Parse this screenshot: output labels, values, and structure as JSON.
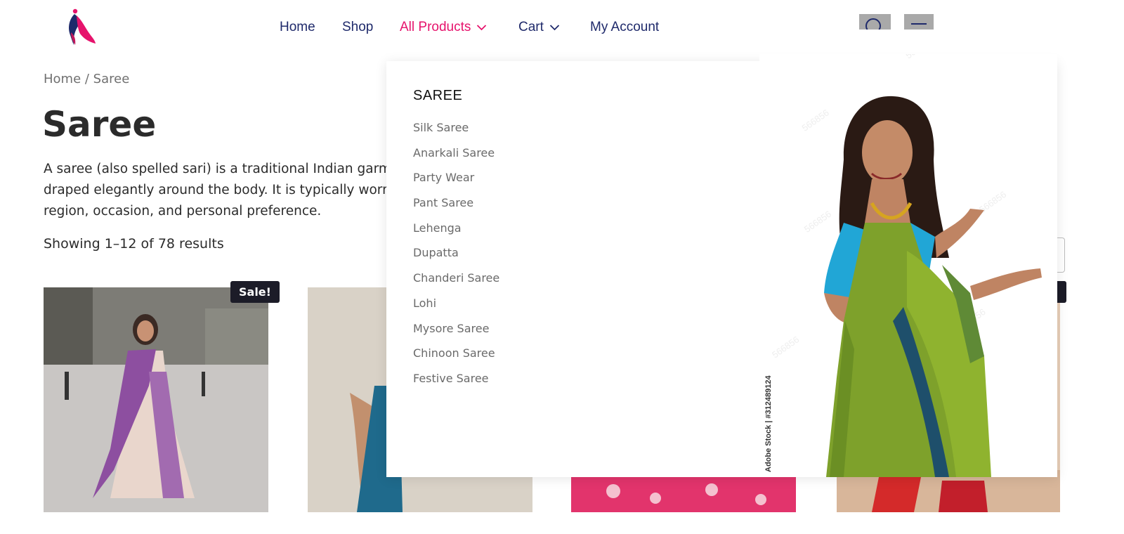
{
  "header": {
    "logo_name": "saree-brand-logo",
    "nav": [
      {
        "label": "Home"
      },
      {
        "label": "Shop"
      },
      {
        "label": "All Products"
      },
      {
        "label": "Cart"
      },
      {
        "label": "My Account"
      }
    ],
    "active_color": "#e6136c",
    "nav_color": "#1f2a6b"
  },
  "breadcrumb": {
    "home": "Home",
    "separator": " / ",
    "current": "Saree"
  },
  "page": {
    "title": "Saree",
    "description_visible": "A saree (also spelled sari) is a traditional Indian garmen… draped elegantly around the body. It is typically worn w… region, occasion, and personal preference.",
    "line1": "A saree (also spelled sari) is a traditional Indian garmen",
    "line2": "draped elegantly around the body. It is typically worn w",
    "line3": "region, occasion, and personal preference.",
    "result_count": "Showing 1–12 of 78 results"
  },
  "products": [
    {
      "badge": "Sale!",
      "image": "purple-silk-saree-photo"
    },
    {
      "image": "teal-saree-photo"
    },
    {
      "image": "pink-saree-photo"
    },
    {
      "image": "red-gold-saree-photo"
    }
  ],
  "mega_menu": {
    "heading": "SAREE",
    "items": [
      {
        "label": "Silk Saree"
      },
      {
        "label": "Anarkali Saree"
      },
      {
        "label": "Party Wear"
      },
      {
        "label": "Pant Saree"
      },
      {
        "label": "Lehenga"
      },
      {
        "label": "Dupatta"
      },
      {
        "label": "Chanderi Saree"
      },
      {
        "label": "Lohi"
      },
      {
        "label": "Mysore Saree"
      },
      {
        "label": "Chinoon Saree"
      },
      {
        "label": "Festive Saree"
      }
    ],
    "image": "woman-in-green-saree-photo",
    "credit": "Adobe Stock | #312489124"
  }
}
